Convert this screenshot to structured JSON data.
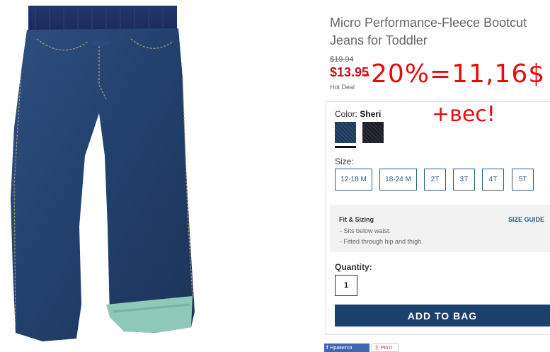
{
  "product": {
    "title": "Micro Performance-Fleece Bootcut Jeans for Toddler",
    "old_price": "$19.94",
    "sale_price": "$13.95",
    "hot_deal": "Hot Deal",
    "image_icon": "jeans-product-image"
  },
  "annotations": {
    "price_note": "-20%=11,16$",
    "weight_note": "+вес!"
  },
  "color": {
    "label": "Color:",
    "selected": "Sheri",
    "swatches": [
      "#25406a",
      "#23262f"
    ]
  },
  "size": {
    "label": "Size:",
    "options": [
      "12-18 M",
      "18-24 M",
      "2T",
      "3T",
      "4T",
      "5T"
    ]
  },
  "fit": {
    "title": "Fit & Sizing",
    "size_guide": "SIZE GUIDE",
    "lines": [
      "- Sits below waist.",
      "- Fitted through hip and thigh."
    ]
  },
  "quantity": {
    "label": "Quantity:",
    "value": "1"
  },
  "add_to_bag": "ADD TO BAG",
  "social": {
    "facebook": "Нравится",
    "pinterest": "Pin it"
  },
  "colors": {
    "accent": "#1a416b",
    "sale": "#c3121e",
    "annotation": "#e60b0b",
    "size_border": "#2a5e86"
  }
}
